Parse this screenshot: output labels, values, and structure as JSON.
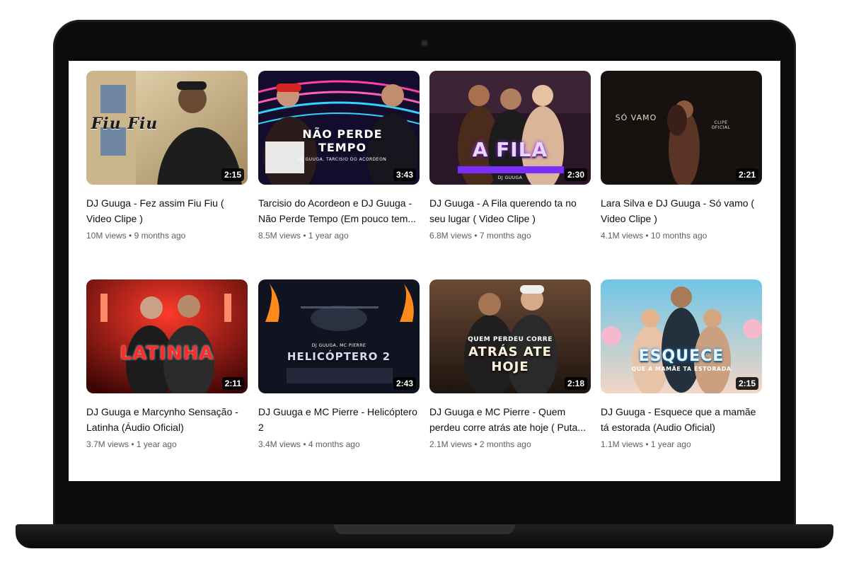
{
  "videos": [
    {
      "title": "DJ Guuga - Fez assim Fiu Fiu ( Video Clipe )",
      "views": "10M views",
      "age": "9 months ago",
      "duration": "2:15",
      "thumb_text": "Fiu Fiu",
      "thumb_subtext": ""
    },
    {
      "title": "Tarcisio do Acordeon e DJ Guuga - Não Perde Tempo (Em pouco tem...",
      "views": "8.5M views",
      "age": "1 year ago",
      "duration": "3:43",
      "thumb_text": "NÃO PERDE TEMPO",
      "thumb_subtext": "DJ GUUGA, TARCISIO DO ACORDEON"
    },
    {
      "title": "DJ Guuga - A Fila querendo ta no seu lugar ( Video Clipe )",
      "views": "6.8M views",
      "age": "7 months ago",
      "duration": "2:30",
      "thumb_text": "A FILA",
      "thumb_subtext": "DJ GUUGA"
    },
    {
      "title": "Lara Silva e DJ Guuga - Só vamo ( Video Clipe )",
      "views": "4.1M views",
      "age": "10 months ago",
      "duration": "2:21",
      "thumb_text": "SÓ VAMO",
      "thumb_subtext": "CLIPE OFICIAL"
    },
    {
      "title": "DJ Guuga e Marcynho Sensação - Latinha (Áudio Oficial)",
      "views": "3.7M views",
      "age": "1 year ago",
      "duration": "2:11",
      "thumb_text": "LATINHA",
      "thumb_subtext": ""
    },
    {
      "title": "DJ Guuga e MC Pierre - Helicóptero 2",
      "views": "3.4M views",
      "age": "4 months ago",
      "duration": "2:43",
      "thumb_text": "HELICÓPTERO 2",
      "thumb_subtext": "DJ GUUGA, MC PIERRE"
    },
    {
      "title": "DJ Guuga e MC Pierre - Quem perdeu corre atrás ate hoje ( Puta...",
      "views": "2.1M views",
      "age": "2 months ago",
      "duration": "2:18",
      "thumb_text": "ATRÁS ATE HOJE",
      "thumb_subtext": "QUEM PERDEU CORRE"
    },
    {
      "title": "DJ Guuga - Esquece que a mamãe tá estorada (Audio Oficial)",
      "views": "1.1M views",
      "age": "1 year ago",
      "duration": "2:15",
      "thumb_text": "ESQUECE",
      "thumb_subtext": "QUE A MAMÃE TA ESTORADA"
    }
  ],
  "colors": {
    "title_text": "#0f0f0f",
    "meta_text": "#606060",
    "bezel": "#0b0b0b"
  }
}
